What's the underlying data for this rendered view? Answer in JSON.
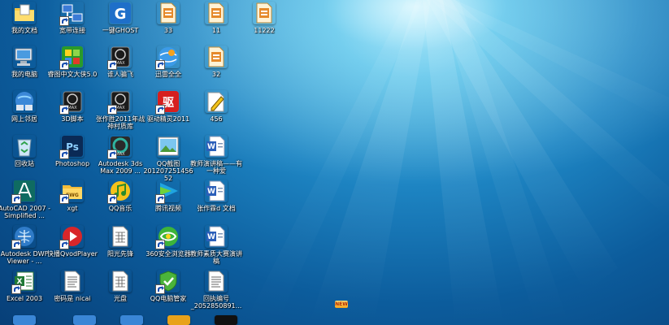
{
  "desktop": {
    "icons": [
      {
        "id": "my-documents",
        "label": "我的文档",
        "icon": "folder-documents-icon",
        "shortcut": false
      },
      {
        "id": "broadband",
        "label": "宽带连接",
        "icon": "network-connection-icon",
        "shortcut": true
      },
      {
        "id": "onekey-ghost",
        "label": "一键GHOST",
        "icon": "ghost-icon",
        "shortcut": false
      },
      {
        "id": "file-33",
        "label": "33",
        "icon": "document-icon",
        "shortcut": false
      },
      {
        "id": "file-11",
        "label": "11",
        "icon": "document-icon",
        "shortcut": false
      },
      {
        "id": "file-11222",
        "label": "11222",
        "icon": "document-icon",
        "shortcut": false
      },
      {
        "id": "my-computer",
        "label": "我的电脑",
        "icon": "computer-icon",
        "shortcut": false
      },
      {
        "id": "ruitu",
        "label": "睿图中文大侠5.0",
        "icon": "green-app-icon",
        "shortcut": true
      },
      {
        "id": "wai-jian-fei",
        "label": "谁人骗飞",
        "icon": "black-app-icon",
        "shortcut": true
      },
      {
        "id": "xunlei",
        "label": "迅雷全全",
        "icon": "globe-icon",
        "shortcut": true
      },
      {
        "id": "file-32",
        "label": "32",
        "icon": "document-icon",
        "shortcut": false
      },
      {
        "id": "network",
        "label": "网上邻居",
        "icon": "network-places-icon",
        "shortcut": false
      },
      {
        "id": "3d-script",
        "label": "3D脚本",
        "icon": "black-app-icon",
        "shortcut": true
      },
      {
        "id": "zhang-2011",
        "label": "张作胜2011年战神村质库",
        "icon": "black-app-icon",
        "shortcut": true
      },
      {
        "id": "driver-genius",
        "label": "驱动精灵2011",
        "icon": "red-app-icon",
        "shortcut": true
      },
      {
        "id": "file-456",
        "label": "456",
        "icon": "pen-document-icon",
        "shortcut": false
      },
      {
        "id": "recycle-bin",
        "label": "回收站",
        "icon": "recycle-bin-icon",
        "shortcut": false
      },
      {
        "id": "photoshop",
        "label": "Photoshop",
        "icon": "photoshop-icon",
        "shortcut": true
      },
      {
        "id": "3dsmax",
        "label": "Autodesk 3ds Max 2009 ...",
        "icon": "3dsmax-icon",
        "shortcut": true
      },
      {
        "id": "qq-screenshot",
        "label": "QQ截图20120725145652",
        "icon": "image-icon",
        "shortcut": false
      },
      {
        "id": "teacher-talk",
        "label": "教师演讲稿——有一种爱",
        "icon": "word-doc-icon",
        "shortcut": false
      },
      {
        "id": "autocad",
        "label": "AutoCAD 2007 - Simplified ...",
        "icon": "autocad-icon",
        "shortcut": true
      },
      {
        "id": "xgt",
        "label": "xgt",
        "icon": "folder-icon",
        "shortcut": true
      },
      {
        "id": "qq-music",
        "label": "QQ音乐",
        "icon": "music-icon",
        "shortcut": true
      },
      {
        "id": "tencent-video",
        "label": "腾讯视频",
        "icon": "video-icon",
        "shortcut": true
      },
      {
        "id": "zhang-doc",
        "label": "张作霖d 文档",
        "icon": "word-doc-icon",
        "shortcut": false
      },
      {
        "id": "dwf-viewer",
        "label": "Autodesk DWF Viewer - ...",
        "icon": "dwf-icon",
        "shortcut": true
      },
      {
        "id": "qvod",
        "label": "快播QvodPlayer",
        "icon": "qvod-icon",
        "shortcut": true
      },
      {
        "id": "sunshine",
        "label": "阳光先锋",
        "icon": "grid-doc-icon",
        "shortcut": false
      },
      {
        "id": "360-browser",
        "label": "360安全浏览器",
        "icon": "browser-360-icon",
        "shortcut": true
      },
      {
        "id": "teacher-speech",
        "label": "教师素质大赛演讲稿",
        "icon": "word-doc-icon",
        "shortcut": false
      },
      {
        "id": "excel",
        "label": "Excel 2003",
        "icon": "excel-icon",
        "shortcut": true
      },
      {
        "id": "password",
        "label": "密码是 nicai",
        "icon": "text-doc-icon",
        "shortcut": false
      },
      {
        "id": "guangpan",
        "label": "光盘",
        "icon": "grid-doc-icon",
        "shortcut": false
      },
      {
        "id": "qq-manager",
        "label": "QQ电脑管家",
        "icon": "shield-icon",
        "shortcut": true
      },
      {
        "id": "receipt-no",
        "label": "回执编号_2052850891...",
        "icon": "text-doc-icon",
        "shortcut": false
      }
    ],
    "bottom_peek_icons": [
      "ie-icon",
      "app-icon",
      "app-icon",
      "ten-icon",
      "penguin-icon"
    ],
    "new_badge": "NEW"
  }
}
